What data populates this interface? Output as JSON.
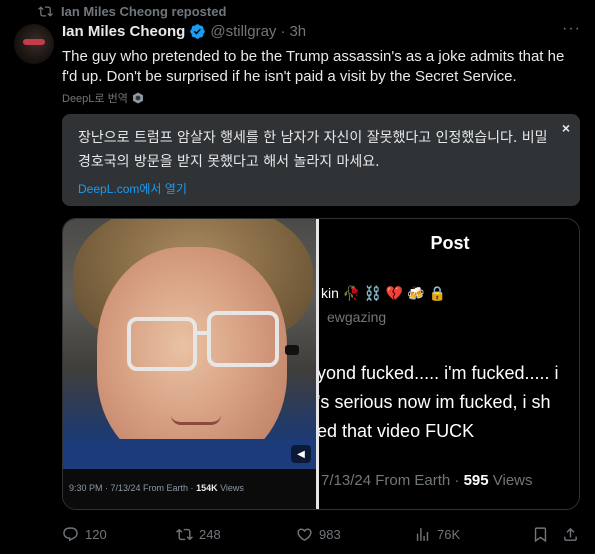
{
  "repost": {
    "label": "Ian Miles Cheong reposted"
  },
  "author": {
    "name": "Ian Miles Cheong",
    "handle": "@stillgray",
    "dot": "·",
    "time": "3h"
  },
  "tweet": {
    "text": "The guy who pretended to be the Trump assassin's as a joke admits that he f'd up. Don't be surprised if he isn't paid a visit by the Secret Service.",
    "translate_label": "DeepL로 번역"
  },
  "translation": {
    "text": "장난으로 트럼프 암살자 행세를 한 남자가 자신이 잘못했다고 인정했습니다. 비밀경호국의 방문을 받지 못했다고 해서 놀라지 마세요.",
    "open_label": "DeepL.com에서 열기",
    "close_glyph": "×"
  },
  "media": {
    "video": {
      "time": "9:30 PM · 7/13/24 From Earth · ",
      "views_count": "154K",
      "views_label": " Views"
    },
    "screenshot": {
      "title": "Post",
      "name_fragment": "kin",
      "emojis": [
        "🥀",
        "⛓️",
        "💔",
        "🍻",
        "🔒"
      ],
      "handle_fragment": "ewgazing",
      "lines": [
        "yond fucked..... i'm fucked..... i",
        "'s serious now im fucked, i sh",
        "ed that video FUCK"
      ],
      "meta_prefix": "7/13/24 From Earth · ",
      "views_count": "595",
      "views_label": " Views"
    }
  },
  "actions": {
    "replies": "120",
    "reposts": "248",
    "likes": "983",
    "views": "76K"
  },
  "colors": {
    "accent": "#1d9bf0",
    "muted": "#71767b",
    "background": "#000000",
    "repost_green": "#00ba7c"
  }
}
